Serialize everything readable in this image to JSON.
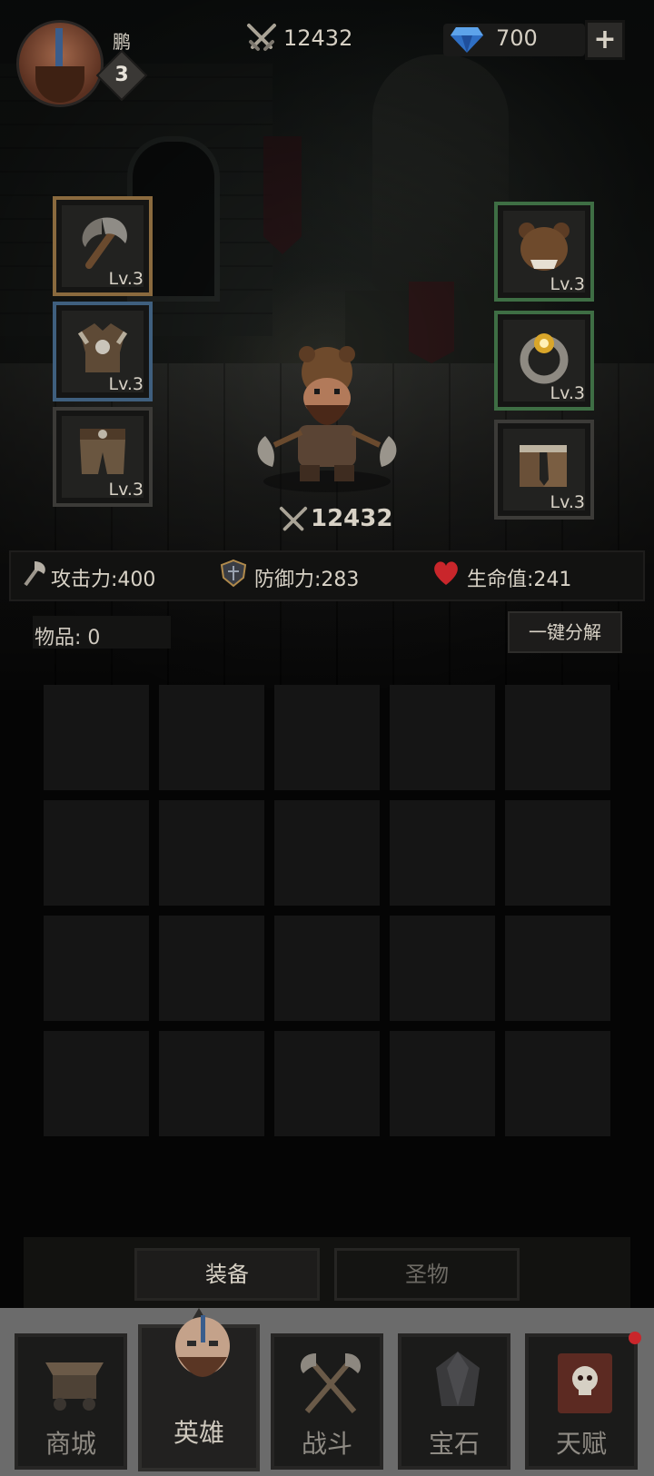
{
  "header": {
    "player_name": "鹏",
    "player_level": "3",
    "combat_power": "12432",
    "gems": "700",
    "add_button": "+"
  },
  "equipment": {
    "left": [
      {
        "slot": "weapon",
        "icon": "axe-icon",
        "level": "Lv.3",
        "frame_color": "#8a6a3e"
      },
      {
        "slot": "armor",
        "icon": "fur-armor-icon",
        "level": "Lv.3",
        "frame_color": "#3f5f7e"
      },
      {
        "slot": "pants",
        "icon": "fur-pants-icon",
        "level": "Lv.3",
        "frame_color": "#3c3b38"
      }
    ],
    "right": [
      {
        "slot": "helmet",
        "icon": "bear-head-icon",
        "level": "Lv.3",
        "frame_color": "#3e6e44"
      },
      {
        "slot": "ring",
        "icon": "ring-icon",
        "level": "Lv.3",
        "frame_color": "#3e6e44"
      },
      {
        "slot": "boots",
        "icon": "fur-boots-icon",
        "level": "Lv.3",
        "frame_color": "#3c3b38"
      }
    ]
  },
  "hero": {
    "power": "12432"
  },
  "stats": {
    "attack": "攻击力:400",
    "defense": "防御力:283",
    "health": "生命值:241"
  },
  "inventory": {
    "count_label": "物品: 0",
    "salvage_button": "一键分解",
    "rows": 4,
    "cols": 5
  },
  "tabs": {
    "equipment": "装备",
    "relics": "圣物"
  },
  "nav": {
    "shop": "商城",
    "hero": "英雄",
    "battle": "战斗",
    "gems": "宝石",
    "talent": "天赋"
  },
  "colors": {
    "background": "#050505",
    "text": "#d8d2c6",
    "notification": "#c9262b"
  }
}
